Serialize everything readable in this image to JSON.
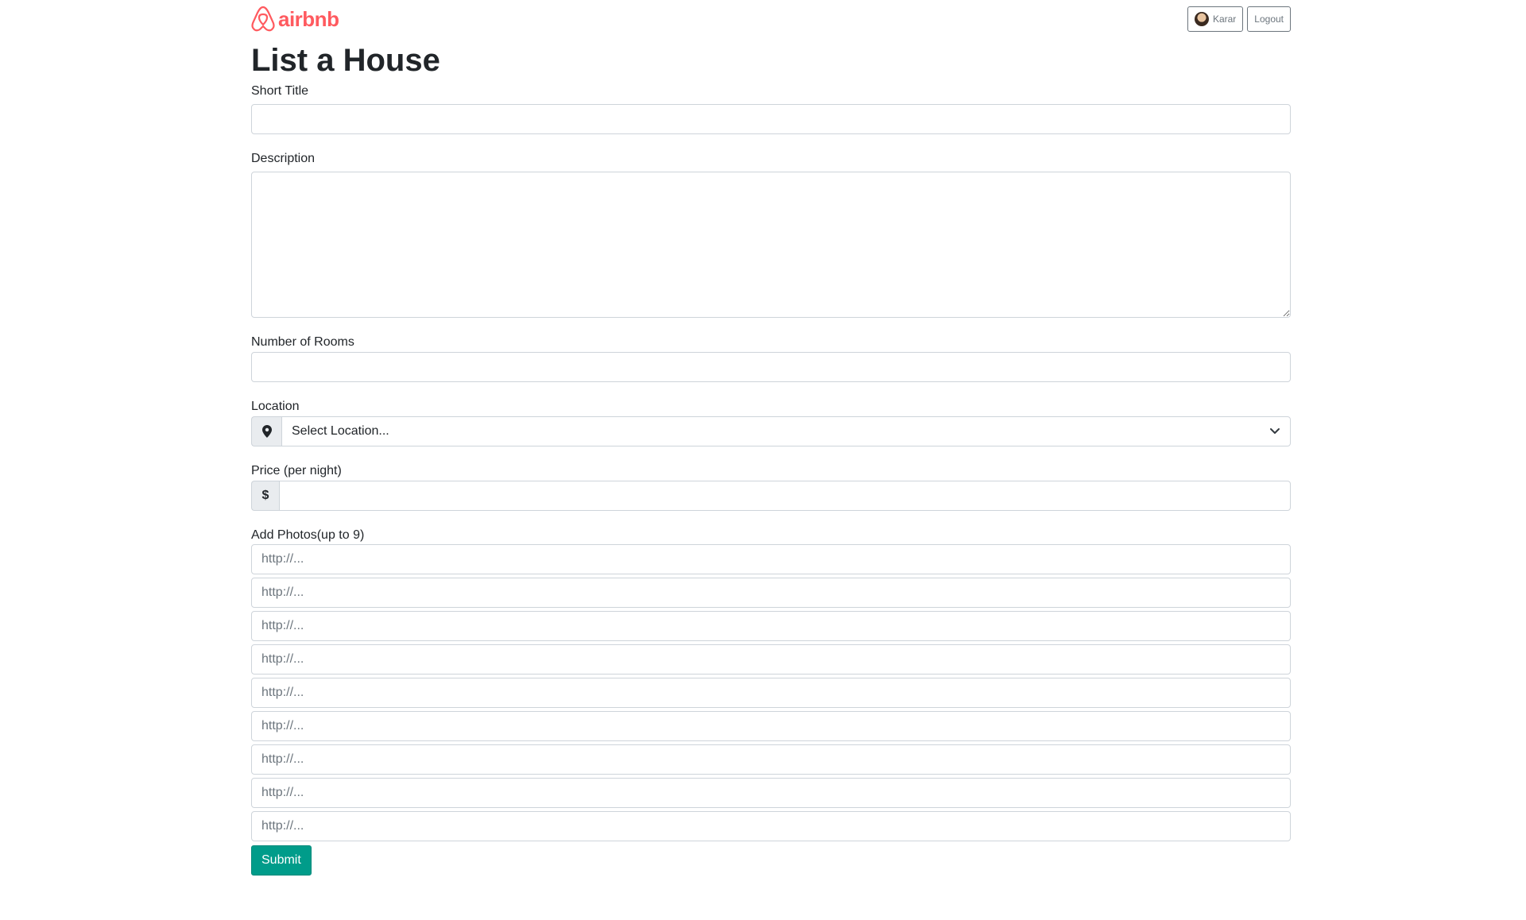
{
  "header": {
    "logo_text": "airbnb",
    "brand_color": "#ff5a5f",
    "user_name": "Karar",
    "logout_label": "Logout"
  },
  "page_title": "List a House",
  "form": {
    "short_title": {
      "label": "Short Title",
      "value": ""
    },
    "description": {
      "label": "Description",
      "value": ""
    },
    "rooms": {
      "label": "Number of Rooms",
      "value": ""
    },
    "location": {
      "label": "Location",
      "selected": "Select Location...",
      "icon": "map-marker-icon"
    },
    "price": {
      "label": "Price (per night)",
      "prefix": "$",
      "value": ""
    },
    "photos": {
      "label": "Add Photos(up to 9)",
      "placeholder": "http://...",
      "count": 9
    },
    "submit_label": "Submit",
    "submit_color": "#009c8a"
  }
}
